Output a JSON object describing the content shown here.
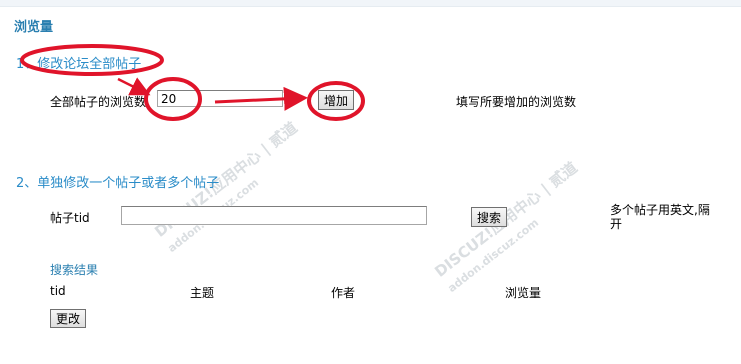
{
  "page": {
    "title": "浏览量"
  },
  "section1": {
    "heading": "1、修改论坛全部帖子",
    "label": "全部帖子的浏览数",
    "value": "20",
    "button": "增加",
    "hint": "填写所要增加的浏览数"
  },
  "section2": {
    "heading": "2、单独修改一个帖子或者多个帖子",
    "tid_label": "帖子tid",
    "tid_value": "",
    "search_button": "搜索",
    "hint": "多个帖子用英文,隔开",
    "results_label": "搜索结果",
    "columns": [
      "tid",
      "主题",
      "作者",
      "浏览量"
    ],
    "update_button": "更改"
  },
  "watermark": {
    "text1": "DISCUZ!应用中心 | 贰道",
    "text2": "addon.discuz.com"
  },
  "colors": {
    "heading": "#2a7fb0",
    "annotation": "#e0142a"
  }
}
